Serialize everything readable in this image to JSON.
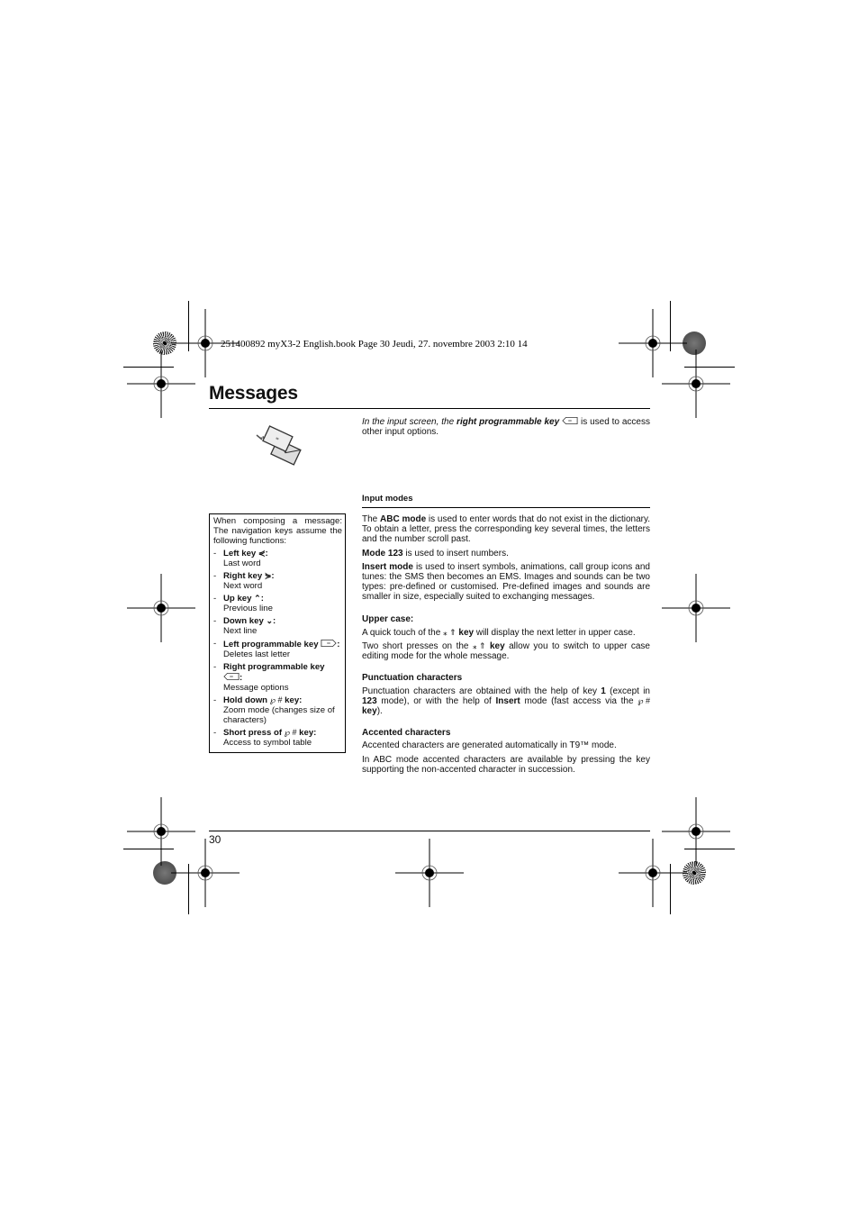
{
  "print_header": {
    "text": "251400892 myX3-2 English.book  Page 30  Jeudi, 27. novembre 2003  2:10 14"
  },
  "page": {
    "title": "Messages",
    "page_number": "30"
  },
  "intro": {
    "italic_prefix": "In the input screen, the ",
    "bold_key": "right programmable key",
    "suffix": " is used to access other input options.",
    "illustration_icon": "envelopes-icon"
  },
  "sidebox": {
    "intro": "When composing a message: The navigation keys assume the following functions:",
    "items": [
      {
        "label": "Left key",
        "glyph": "⋞",
        "icon": "left-key-icon",
        "desc": "Last word"
      },
      {
        "label": "Right key",
        "glyph": "⋟",
        "icon": "right-key-icon",
        "desc": "Next word"
      },
      {
        "label": "Up key",
        "glyph": "⌃",
        "icon": "up-key-icon",
        "desc": "Previous line"
      },
      {
        "label": "Down key",
        "glyph": "⌄",
        "icon": "down-key-icon",
        "desc": "Next line"
      },
      {
        "label": "Left programmable key",
        "icon": "left-softkey-icon",
        "desc": "Deletes last letter"
      },
      {
        "label": "Right programmable key",
        "icon": "right-softkey-icon",
        "desc": "Message options"
      },
      {
        "label": "Hold down",
        "glyph": "℘ #",
        "suffix": "key:",
        "icon": "hash-key-icon",
        "desc": "Zoom mode (changes size of characters)"
      },
      {
        "label": "Short press of",
        "glyph": "℘ #",
        "suffix": "key:",
        "icon": "hash-key-icon",
        "desc": "Access to symbol table"
      }
    ]
  },
  "input_modes": {
    "heading": "Input modes",
    "abc": {
      "bold": "ABC mode",
      "text_before": "The ",
      "text_after": " is used to enter words that do not exist in the dictionary. To obtain a letter, press the corresponding key several times, the letters and the number scroll past."
    },
    "mode123": {
      "bold": "Mode 123",
      "text_after": " is used to insert numbers."
    },
    "insert": {
      "bold": "Insert mode",
      "text_after": " is used to insert symbols, animations, call group icons and tunes: the SMS then becomes an EMS. Images and sounds can be two types: pre-defined or customised. Pre-defined images and sounds are smaller in size, especially suited to exchanging messages."
    }
  },
  "upper_case": {
    "heading": "Upper case:",
    "p1_before": "A quick touch of the ",
    "p1_glyph": "⁎ ⇑",
    "p1_bold": "key",
    "p1_after": " will display the next letter in upper case.",
    "p2_before": "Two short presses on the ",
    "p2_glyph": "⁎ ⇑",
    "p2_bold": "key",
    "p2_after": " allow you to switch to upper case editing mode for the whole message."
  },
  "punctuation": {
    "heading": "Punctuation characters",
    "t1": "Punctuation characters are obtained with the help of key ",
    "b1": "1",
    "t2": " (except in ",
    "b2": "123",
    "t3": " mode), or with the help of ",
    "b3": "Insert",
    "t4": " mode (fast access via the ",
    "glyph": "℘ #",
    "b4": "key",
    "t5": ")."
  },
  "accented": {
    "heading": "Accented characters",
    "p1": "Accented characters are generated automatically in T9™ mode.",
    "p2": "In ABC mode accented characters are available by pressing the key supporting the non-accented character in succession."
  }
}
